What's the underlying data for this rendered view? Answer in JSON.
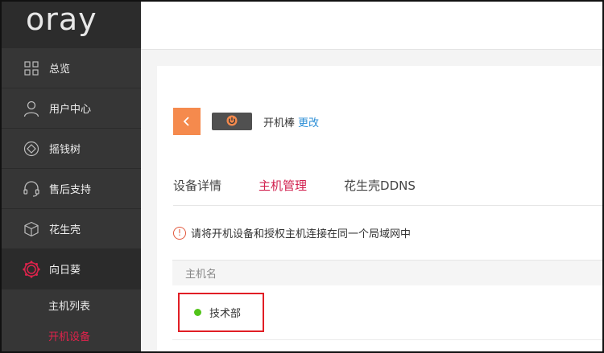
{
  "brand": {
    "logo": "oray"
  },
  "sidebar": {
    "items": [
      {
        "label": "总览",
        "icon": "grid-icon"
      },
      {
        "label": "用户中心",
        "icon": "user-icon"
      },
      {
        "label": "摇钱树",
        "icon": "diamond-icon"
      },
      {
        "label": "售后支持",
        "icon": "headset-icon"
      },
      {
        "label": "花生壳",
        "icon": "cube-icon"
      },
      {
        "label": "向日葵",
        "icon": "sunflower-icon"
      }
    ],
    "sub_items": [
      {
        "label": "主机列表"
      },
      {
        "label": "开机设备"
      }
    ]
  },
  "device": {
    "back_icon": "chevron-left-icon",
    "badge_icon": "power-icon",
    "name": "开机棒",
    "change_label": "更改"
  },
  "tabs": [
    {
      "label": "设备详情"
    },
    {
      "label": "主机管理"
    },
    {
      "label": "花生壳DDNS"
    }
  ],
  "notice": {
    "icon": "warning-icon",
    "text": "请将开机设备和授权主机连接在同一个局域网中"
  },
  "table": {
    "column_header": "主机名",
    "rows": [
      {
        "host_name": "技术部",
        "status": "online"
      }
    ]
  },
  "colors": {
    "accent_red": "#d11f4e",
    "back_button_orange": "#f58a4d",
    "online_green": "#52c41a",
    "link_blue": "#2b8ed6",
    "highlight_border": "#e11e25"
  }
}
